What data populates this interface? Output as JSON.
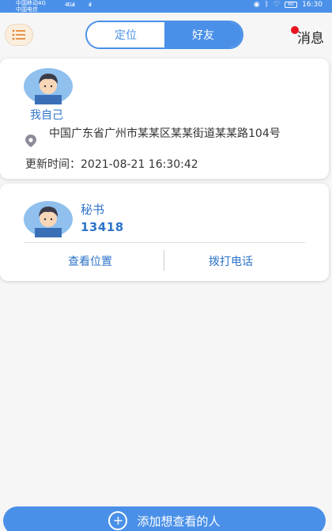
{
  "status_bar": {
    "carrier_line1": "中国移动4G",
    "carrier_line2": "中国电信",
    "signal1": "4G.ııl",
    "signal2": "ııl",
    "battery": "60",
    "time": "16:30"
  },
  "header": {
    "tabs": [
      {
        "label": "定位",
        "active": false
      },
      {
        "label": "好友",
        "active": true
      }
    ],
    "messages_label": "消息"
  },
  "self_card": {
    "name": "我自己",
    "address": "中国广东省广州市某某区某某街道某某路104号",
    "update_time": "更新时间：2021-08-21 16:30:42"
  },
  "friend_card": {
    "name": "秘书",
    "phone": "13418",
    "actions": {
      "view_location": "查看位置",
      "call": "拨打电话"
    }
  },
  "bottom": {
    "add_label": "添加想查看的人"
  },
  "colors": {
    "accent": "#4a90e8",
    "link": "#2e74c9",
    "badge": "#e8141f",
    "menu_bg": "#fbeedd"
  }
}
